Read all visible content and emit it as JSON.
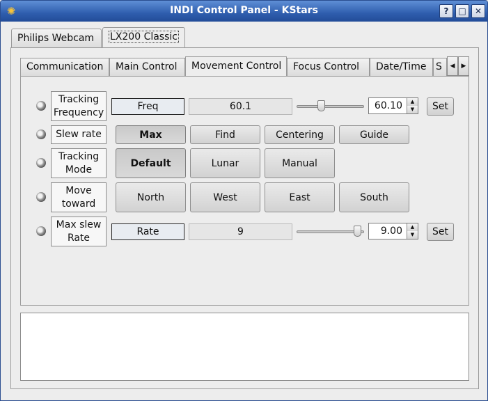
{
  "window": {
    "title": "INDI Control Panel - KStars",
    "help_button": "?",
    "maximize_button": "□",
    "close_button": "✕"
  },
  "device_tabs": [
    {
      "label": "Philips Webcam"
    },
    {
      "label": "LX200 Classic",
      "active": true
    }
  ],
  "group_tabs": [
    {
      "label": "Communication"
    },
    {
      "label": "Main Control"
    },
    {
      "label": "Movement Control",
      "active": true
    },
    {
      "label": "Focus Control"
    },
    {
      "label": "Date/Time"
    },
    {
      "label": "S"
    }
  ],
  "properties": {
    "tracking_frequency": {
      "label": "Tracking\nFrequency",
      "element_name": "Freq",
      "value": "60.1",
      "input_value": "60.10",
      "slider_fraction": 0.35,
      "set_label": "Set"
    },
    "slew_rate": {
      "label": "Slew rate",
      "options": [
        "Max",
        "Find",
        "Centering",
        "Guide"
      ],
      "selected": "Max"
    },
    "tracking_mode": {
      "label": "Tracking\nMode",
      "options": [
        "Default",
        "Lunar",
        "Manual"
      ],
      "selected": "Default"
    },
    "move_toward": {
      "label": "Move\ntoward",
      "options": [
        "North",
        "West",
        "East",
        "South"
      ]
    },
    "max_slew_rate": {
      "label": "Max slew\nRate",
      "element_name": "Rate",
      "value": "9",
      "input_value": "9.00",
      "slider_fraction": 0.95,
      "set_label": "Set"
    }
  },
  "log": {
    "text": ""
  },
  "colors": {
    "titlebar": "#2f5eae",
    "window_bg": "#ededed",
    "led_idle": "#7a7a7a"
  }
}
